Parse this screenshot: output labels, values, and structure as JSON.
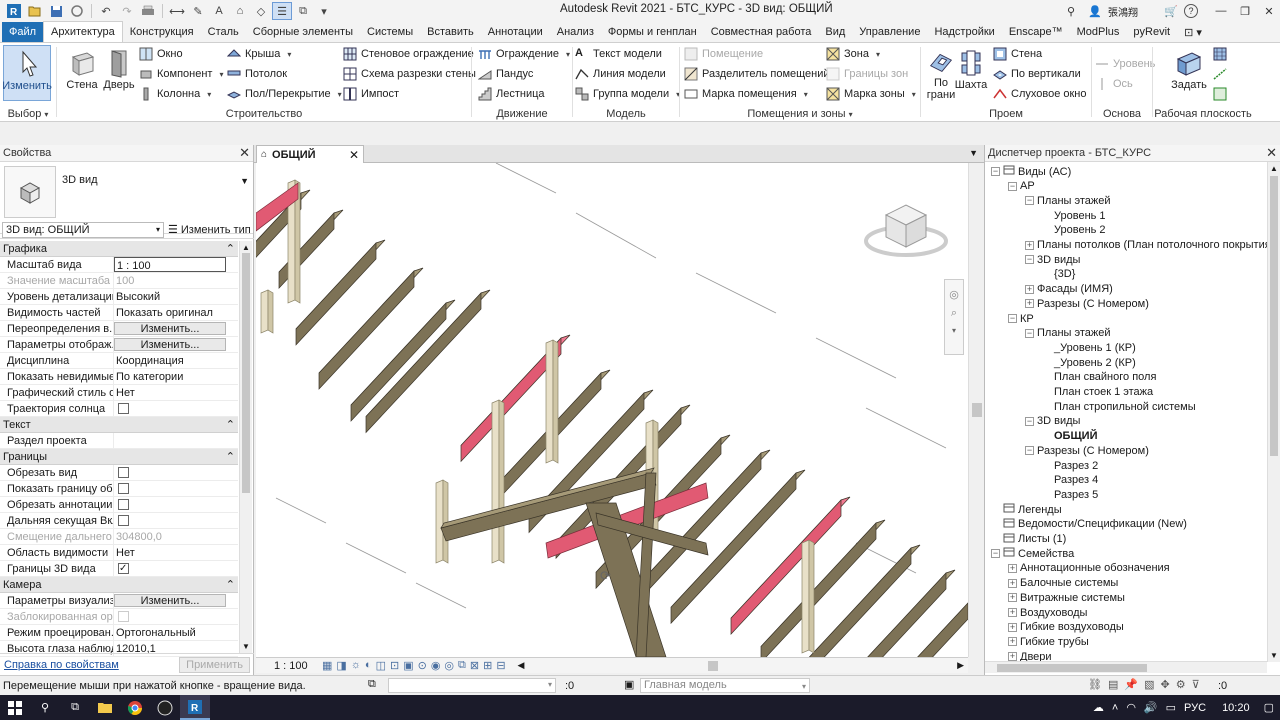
{
  "app": {
    "title": "Autodesk Revit 2021 - БТС_КУРС - 3D вид: ОБЩИЙ",
    "user": "張鴻翔",
    "help": "?",
    "accent": "#1f6fb5"
  },
  "ribbon": {
    "tabs": [
      "Файл",
      "Архитектура",
      "Конструкция",
      "Сталь",
      "Сборные элементы",
      "Системы",
      "Вставить",
      "Аннотации",
      "Анализ",
      "Формы и генплан",
      "Совместная работа",
      "Вид",
      "Управление",
      "Надстройки",
      "Enscape™",
      "ModPlus",
      "pyRevit"
    ],
    "active_tab": "Архитектура",
    "select": {
      "modify": "Изменить",
      "title": "Выбор"
    },
    "build": {
      "wall": "Стена",
      "door": "Дверь",
      "window": "Окно",
      "component": "Компонент",
      "column": "Колонна",
      "roof": "Крыша",
      "ceiling": "Потолок",
      "floor": "Пол/Перекрытие",
      "curtain_system": "Стеновое ограждение",
      "curtain_grid": "Схема разрезки стены",
      "mullion": "Импост",
      "title": "Строительство"
    },
    "circulation": {
      "railing": "Ограждение",
      "ramp": "Пандус",
      "stair": "Лестница",
      "title": "Движение"
    },
    "model": {
      "text": "Текст модели",
      "line": "Линия модели",
      "group": "Группа модели",
      "title": "Модель"
    },
    "room": {
      "room": "Помещение",
      "separator": "Разделитель помещений",
      "tag": "Марка помещения",
      "area": "Зона",
      "area_boundary": "Границы зон",
      "area_tag": "Марка зоны",
      "title": "Помещения и зоны"
    },
    "opening": {
      "by_face": "По грани",
      "shaft": "Шахта",
      "wall": "Стена",
      "vertical": "По вертикали",
      "dormer": "Слуховое окно",
      "title": "Проем"
    },
    "datum": {
      "level": "Уровень",
      "grid": "Ось",
      "title": "Основа"
    },
    "workplane": {
      "set": "Задать",
      "title": "Рабочая плоскость"
    }
  },
  "properties": {
    "header": "Свойства",
    "type_name": "3D вид",
    "instance_selector": "3D вид: ОБЩИЙ",
    "edit_type": "Изменить тип",
    "sections": [
      {
        "name": "Графика",
        "rows": [
          {
            "key": "Масштаб вида",
            "value": "1 : 100",
            "kind": "input"
          },
          {
            "key": "Значение масштаба",
            "value": "100",
            "kind": "gray"
          },
          {
            "key": "Уровень детализации",
            "value": "Высокий",
            "kind": "text"
          },
          {
            "key": "Видимость частей",
            "value": "Показать оригинал",
            "kind": "text"
          },
          {
            "key": "Переопределения в...",
            "value": "Изменить...",
            "kind": "button"
          },
          {
            "key": "Параметры отображ...",
            "value": "Изменить...",
            "kind": "button"
          },
          {
            "key": "Дисциплина",
            "value": "Координация",
            "kind": "text"
          },
          {
            "key": "Показать невидимые...",
            "value": "По категории",
            "kind": "text"
          },
          {
            "key": "Графический стиль о...",
            "value": "Нет",
            "kind": "text"
          },
          {
            "key": "Траектория солнца",
            "value": "",
            "kind": "checkbox",
            "checked": false
          }
        ]
      },
      {
        "name": "Текст",
        "rows": [
          {
            "key": "Раздел проекта",
            "value": "",
            "kind": "text"
          }
        ]
      },
      {
        "name": "Границы",
        "rows": [
          {
            "key": "Обрезать вид",
            "value": "",
            "kind": "checkbox",
            "checked": false
          },
          {
            "key": "Показать границу об...",
            "value": "",
            "kind": "checkbox",
            "checked": false
          },
          {
            "key": "Обрезать аннотации",
            "value": "",
            "kind": "checkbox",
            "checked": false
          },
          {
            "key": "Дальняя секущая Вкл",
            "value": "",
            "kind": "checkbox",
            "checked": false
          },
          {
            "key": "Смещение дальнего ...",
            "value": "304800,0",
            "kind": "gray"
          },
          {
            "key": "Область видимости",
            "value": "Нет",
            "kind": "text"
          },
          {
            "key": "Границы 3D вида",
            "value": "",
            "kind": "checkbox",
            "checked": true
          }
        ]
      },
      {
        "name": "Камера",
        "rows": [
          {
            "key": "Параметры визуализ...",
            "value": "Изменить...",
            "kind": "button"
          },
          {
            "key": "Заблокированная ор...",
            "value": "",
            "kind": "checkbox-dim",
            "checked": false
          },
          {
            "key": "Режим проецирован...",
            "value": "Ортогональный",
            "kind": "text"
          },
          {
            "key": "Высота глаза наблюд...",
            "value": "12010,1",
            "kind": "text"
          }
        ]
      }
    ],
    "help_link": "Справка по свойствам",
    "apply": "Применить"
  },
  "view": {
    "tab_label": "ОБЩИЙ",
    "scale": "1 : 100",
    "beam_colors": {
      "timber": "#7d7256",
      "timber_top": "#a69a78",
      "post": "#e8e0c8",
      "highlight": "#e15a73"
    }
  },
  "browser": {
    "header": "Диспетчер проекта - БТС_КУРС",
    "tree": [
      {
        "label": "Виды (АС)",
        "depth": 0,
        "toggle": "−",
        "icon": true
      },
      {
        "label": "АР",
        "depth": 1,
        "toggle": "−"
      },
      {
        "label": "Планы этажей",
        "depth": 2,
        "toggle": "−"
      },
      {
        "label": "Уровень 1",
        "depth": 3
      },
      {
        "label": "Уровень 2",
        "depth": 3
      },
      {
        "label": "Планы потолков (План потолочного покрытия)",
        "depth": 2,
        "toggle": "+"
      },
      {
        "label": "3D виды",
        "depth": 2,
        "toggle": "−"
      },
      {
        "label": "{3D}",
        "depth": 3
      },
      {
        "label": "Фасады (ИМЯ)",
        "depth": 2,
        "toggle": "+"
      },
      {
        "label": "Разрезы (С Номером)",
        "depth": 2,
        "toggle": "+"
      },
      {
        "label": "КР",
        "depth": 1,
        "toggle": "−"
      },
      {
        "label": "Планы этажей",
        "depth": 2,
        "toggle": "−"
      },
      {
        "label": "_Уровень 1 (КР)",
        "depth": 3
      },
      {
        "label": "_Уровень 2 (КР)",
        "depth": 3
      },
      {
        "label": "План свайного поля",
        "depth": 3
      },
      {
        "label": "План стоек 1 этажа",
        "depth": 3
      },
      {
        "label": "План стропильной системы",
        "depth": 3
      },
      {
        "label": "3D виды",
        "depth": 2,
        "toggle": "−"
      },
      {
        "label": "ОБЩИЙ",
        "depth": 3,
        "bold": true
      },
      {
        "label": "Разрезы (С Номером)",
        "depth": 2,
        "toggle": "−"
      },
      {
        "label": "Разрез 2",
        "depth": 3
      },
      {
        "label": "Разрез 4",
        "depth": 3
      },
      {
        "label": "Разрез 5",
        "depth": 3
      },
      {
        "label": "Легенды",
        "depth": 0,
        "icon": true
      },
      {
        "label": "Ведомости/Спецификации (New)",
        "depth": 0,
        "icon": true
      },
      {
        "label": "Листы (1)",
        "depth": 0,
        "icon": true
      },
      {
        "label": "Семейства",
        "depth": 0,
        "toggle": "−",
        "icon": true
      },
      {
        "label": "Аннотационные обозначения",
        "depth": 1,
        "toggle": "+"
      },
      {
        "label": "Балочные системы",
        "depth": 1,
        "toggle": "+"
      },
      {
        "label": "Витражные системы",
        "depth": 1,
        "toggle": "+"
      },
      {
        "label": "Воздуховоды",
        "depth": 1,
        "toggle": "+"
      },
      {
        "label": "Гибкие воздуховоды",
        "depth": 1,
        "toggle": "+"
      },
      {
        "label": "Гибкие трубы",
        "depth": 1,
        "toggle": "+"
      },
      {
        "label": "Двери",
        "depth": 1,
        "toggle": "+"
      }
    ]
  },
  "statusbar": {
    "message": "Перемещение мыши при нажатой кнопке - вращение вида.",
    "worksets_count": ":0",
    "model": "Главная модель",
    "filter_count": ":0"
  },
  "taskbar": {
    "lang": "РУС",
    "time": "10:20"
  }
}
